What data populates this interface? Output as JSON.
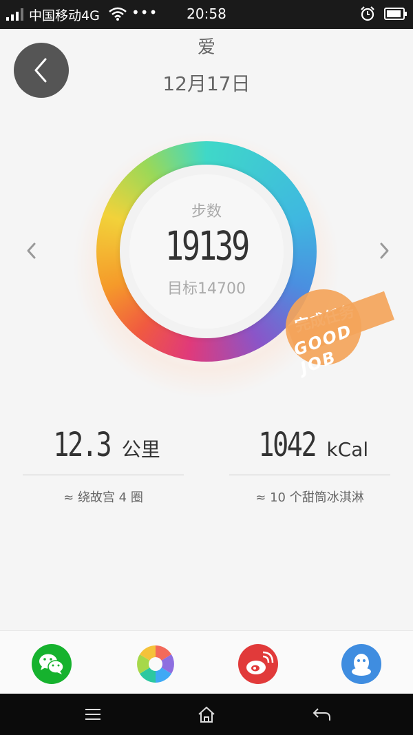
{
  "status_bar": {
    "carrier": "中国移动4G",
    "time": "20:58",
    "more": "•••",
    "icons": [
      "signal-icon",
      "wifi-icon",
      "alarm-icon",
      "battery-icon"
    ]
  },
  "header": {
    "title": "爱",
    "date": "12月17日"
  },
  "ring": {
    "label": "步数",
    "steps": "19139",
    "goal": "目标14700"
  },
  "stamp": {
    "circle_text": "完成任务",
    "band_text": "GOOD JOB"
  },
  "stats": {
    "distance": {
      "value": "12.3",
      "unit": "公里",
      "note": "≈ 绕故宫 4 圈"
    },
    "calories": {
      "value": "1042",
      "unit": "kCal",
      "note": "≈ 10 个甜筒冰淇淋"
    }
  },
  "share": {
    "items": [
      "wechat-icon",
      "camera-icon",
      "weibo-icon",
      "qq-icon"
    ]
  },
  "colors": {
    "accent_green": "#16b22e",
    "weibo_red": "#e13a3a",
    "qq_blue": "#3f8de0",
    "stamp_orange": "#f3a45a"
  }
}
